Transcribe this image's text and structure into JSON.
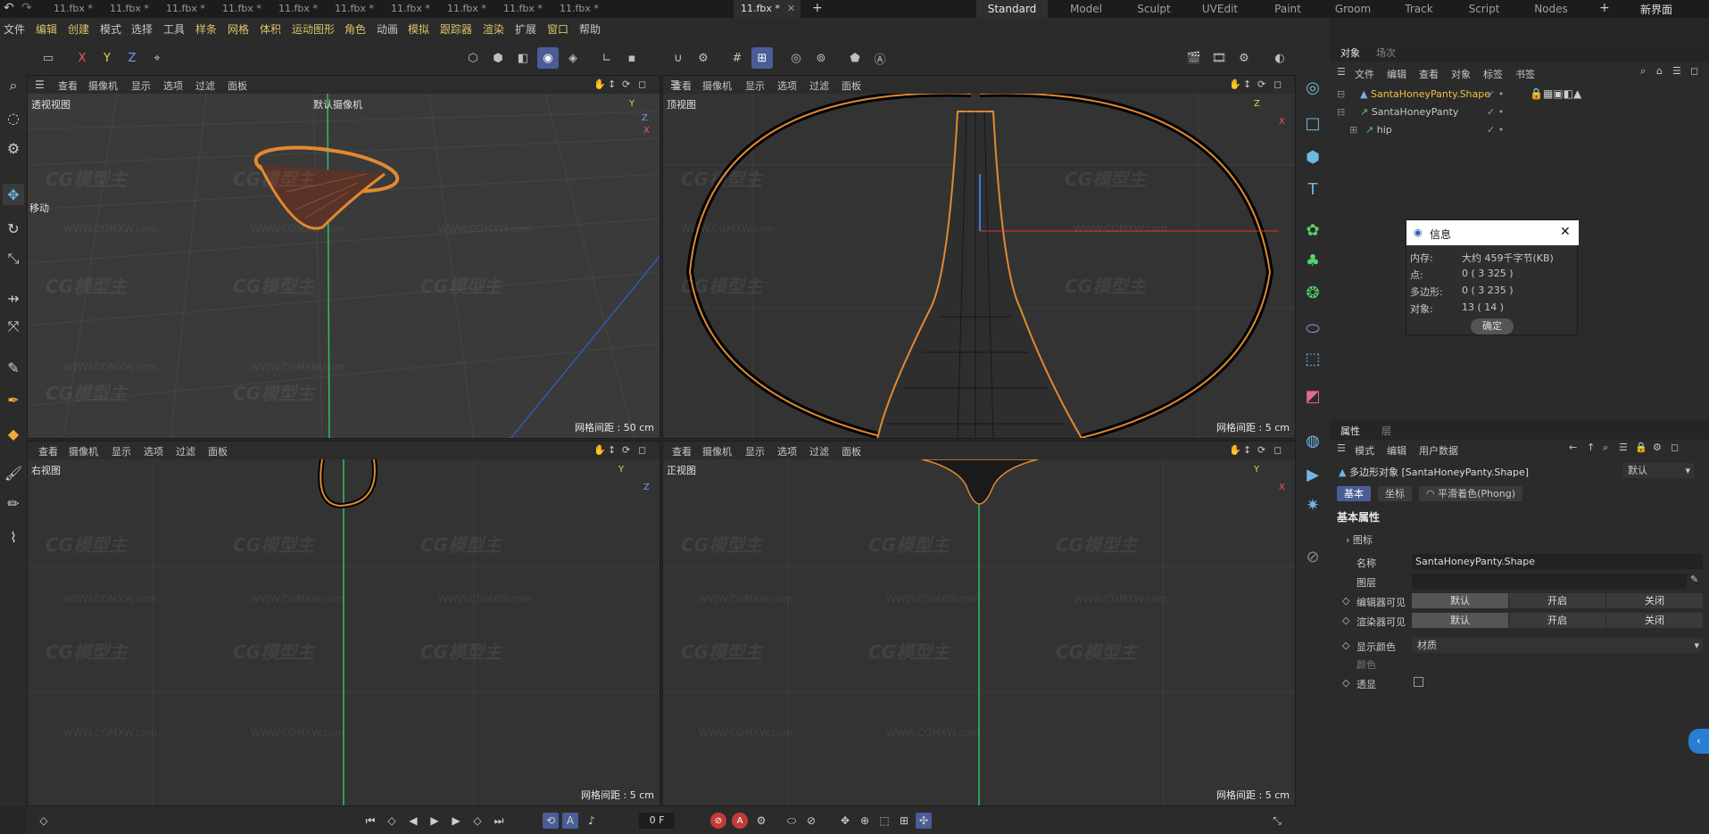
{
  "file_tabs": [
    {
      "label": "11.fbx *"
    },
    {
      "label": "11.fbx *"
    },
    {
      "label": "11.fbx *"
    },
    {
      "label": "11.fbx *"
    },
    {
      "label": "11.fbx *"
    },
    {
      "label": "11.fbx *"
    },
    {
      "label": "11.fbx *"
    },
    {
      "label": "11.fbx *"
    },
    {
      "label": "11.fbx *"
    },
    {
      "label": "11.fbx *"
    },
    {
      "label": "11.fbx *"
    }
  ],
  "layouts": [
    "Standard",
    "Model",
    "Sculpt",
    "UVEdit",
    "Paint",
    "Groom",
    "Track",
    "Script",
    "Nodes"
  ],
  "new_interface": "新界面",
  "menus": [
    "文件",
    "编辑",
    "创建",
    "模式",
    "选择",
    "工具",
    "样条",
    "网格",
    "体积",
    "运动图形",
    "角色",
    "动画",
    "模拟",
    "跟踪器",
    "渲染",
    "扩展",
    "窗口",
    "帮助"
  ],
  "toolbar": {
    "x": "X",
    "y": "Y",
    "z": "Z"
  },
  "viewport_menu": [
    "查看",
    "摄像机",
    "显示",
    "选项",
    "过滤",
    "面板"
  ],
  "viewports": {
    "perspective": {
      "name": "透视视图",
      "camera": "默认摄像机",
      "grid": "网格间距 : 50 cm",
      "move_label": "移动"
    },
    "top": {
      "name": "顶视图",
      "grid": "网格间距 : 5 cm"
    },
    "right": {
      "name": "右视图",
      "grid": "网格间距 : 5 cm"
    },
    "front": {
      "name": "正视图",
      "grid": "网格间距 : 5 cm"
    }
  },
  "watermark": "CG模型主",
  "watermark_url": "WWW.CGMXW.com",
  "objects_panel": {
    "tabs": [
      "对象",
      "场次"
    ],
    "menu": [
      "文件",
      "编辑",
      "查看",
      "对象",
      "标签",
      "书签"
    ],
    "items": [
      {
        "label": "SantaHoneyPanty.Shape",
        "selected": true
      },
      {
        "label": "SantaHoneyPanty",
        "selected": false
      },
      {
        "label": "hip",
        "selected": false
      }
    ]
  },
  "info_dialog": {
    "title": "信息",
    "rows": [
      {
        "k": "内存:",
        "v": "大约 459千字节(KB)"
      },
      {
        "k": "点:",
        "v": "0 ( 3 325 )"
      },
      {
        "k": "多边形:",
        "v": "0 ( 3 235 )"
      },
      {
        "k": "对象:",
        "v": "13 ( 14 )"
      }
    ],
    "ok": "确定"
  },
  "attributes": {
    "tabs": [
      "属性",
      "层"
    ],
    "menu": [
      "模式",
      "编辑",
      "用户数据"
    ],
    "object_title": "多边形对象 [SantaHoneyPanty.Shape]",
    "preset": "默认",
    "subtabs": [
      "基本",
      "坐标",
      "平滑着色(Phong)"
    ],
    "section": "基本属性",
    "icon_label": "图标",
    "name_label": "名称",
    "name_value": "SantaHoneyPanty.Shape",
    "layer_label": "图层",
    "editor_visible": "编辑器可见",
    "render_visible": "渲染器可见",
    "opt_default": "默认",
    "opt_on": "开启",
    "opt_off": "关闭",
    "display_color": "显示颜色",
    "material": "材质",
    "color_label": "颜色",
    "xray": "透显"
  },
  "timeline": {
    "frame": "0 F"
  },
  "colors": {
    "accent": "#4b5d96",
    "selected_text": "#f0c040",
    "mesh": "#e08a30"
  }
}
